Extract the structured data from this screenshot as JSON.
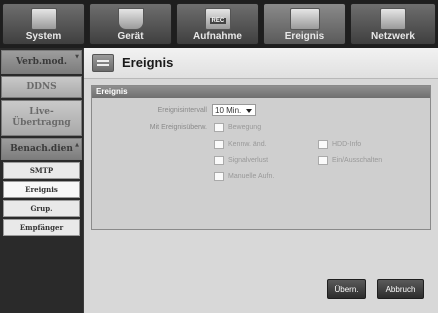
{
  "tabs": [
    {
      "label": "System"
    },
    {
      "label": "Gerät"
    },
    {
      "label": "Aufnahme",
      "badge": "REC"
    },
    {
      "label": "Ereignis"
    },
    {
      "label": "Netzwerk"
    }
  ],
  "sidebar": {
    "items": [
      {
        "label": "Verb.mod."
      },
      {
        "label": "DDNS"
      },
      {
        "label": "Live-\nÜbertragng"
      },
      {
        "label": "Benach.dien"
      }
    ],
    "subitems": [
      {
        "label": "SMTP"
      },
      {
        "label": "Ereignis"
      },
      {
        "label": "Grup."
      },
      {
        "label": "Empfänger"
      }
    ]
  },
  "page": {
    "title": "Ereignis",
    "section_title": "Ereignis",
    "interval_label": "Ereignisintervall",
    "interval_value": "10 Min.",
    "monitor_label": "Mit Ereignisüberw.",
    "options": {
      "motion": "Bewegung",
      "pw_change": "Kennw. änd.",
      "hdd_info": "HDD-Info",
      "video_loss": "Signalverlust",
      "power": "Ein/Ausschalten",
      "manual_rec": "Manuelle Aufn."
    }
  },
  "buttons": {
    "apply": "Übern.",
    "cancel": "Abbruch"
  }
}
